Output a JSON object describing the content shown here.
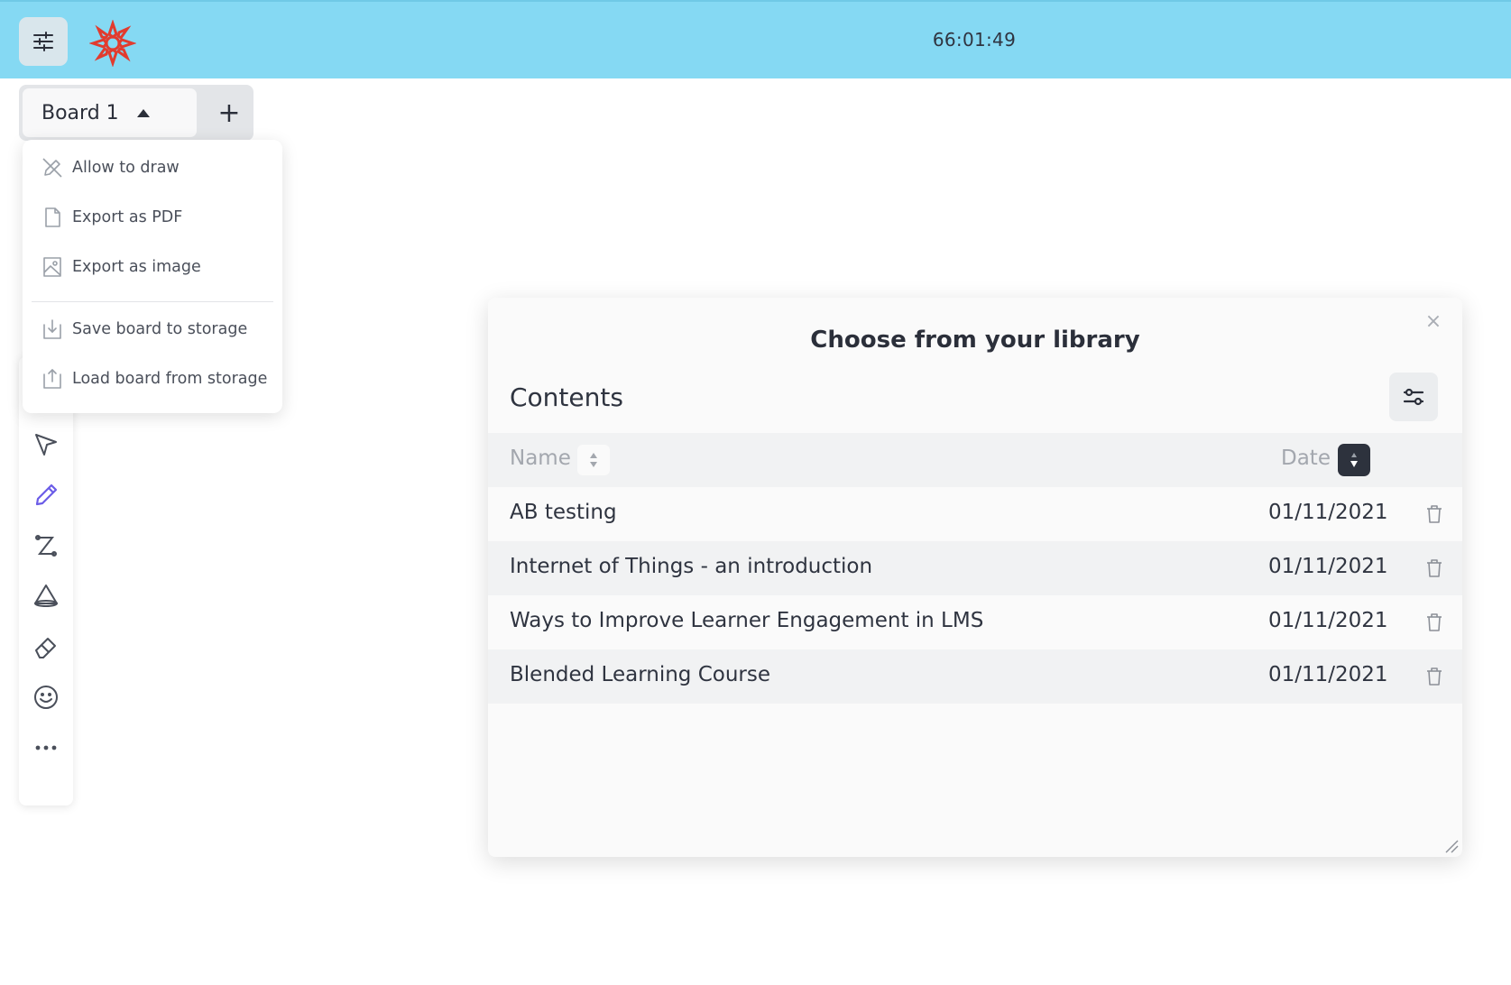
{
  "header": {
    "timer": "66:01:49",
    "bg_color": "#85d9f3"
  },
  "board": {
    "tab_label": "Board 1",
    "add_label": "+"
  },
  "board_menu": {
    "items": [
      {
        "label": "Allow to draw",
        "icon": "pencil-off-icon"
      },
      {
        "label": "Export as PDF",
        "icon": "file-icon"
      },
      {
        "label": "Export as image",
        "icon": "image-file-icon"
      },
      {
        "label": "Save board to storage",
        "icon": "download-file-icon"
      },
      {
        "label": "Load board from storage",
        "icon": "upload-file-icon"
      }
    ]
  },
  "toolbar": {
    "tools": [
      "pointer-icon",
      "pencil-icon",
      "curve-icon",
      "shape-icon",
      "eraser-icon",
      "emoji-icon",
      "more-icon"
    ],
    "active_tool": "pencil-icon",
    "active_color": "#6b5ce7"
  },
  "library": {
    "title": "Choose from your library",
    "close": "×",
    "section_label": "Contents",
    "columns": {
      "name": "Name",
      "date": "Date"
    },
    "rows": [
      {
        "name": "AB testing",
        "date": "01/11/2021"
      },
      {
        "name": "Internet of Things - an introduction",
        "date": "01/11/2021"
      },
      {
        "name": "Ways to Improve Learner Engagement in LMS",
        "date": "01/11/2021"
      },
      {
        "name": "Blended Learning Course",
        "date": "01/11/2021"
      }
    ]
  }
}
